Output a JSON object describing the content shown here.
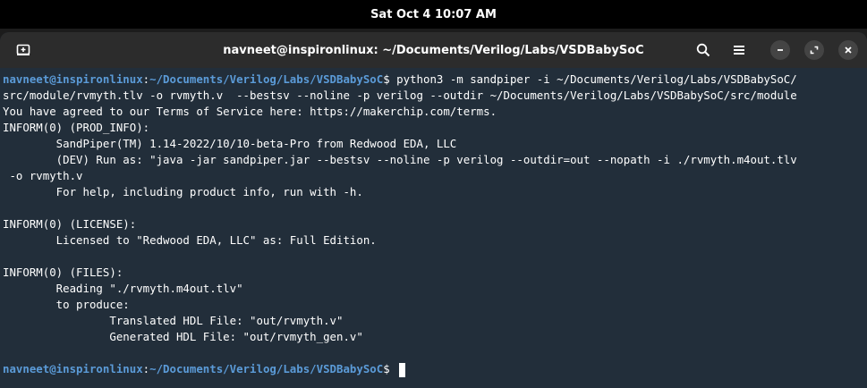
{
  "system": {
    "clock": "Sat Oct 4  10:07 AM"
  },
  "window": {
    "title": "navneet@inspironlinux: ~/Documents/Verilog/Labs/VSDBabySoC",
    "icons": [
      "new-tab-icon",
      "search-icon",
      "menu-icon",
      "minimize-icon",
      "maximize-icon",
      "close-icon"
    ]
  },
  "colors": {
    "terminal_bg": "#222e3a",
    "prompt_blue": "#5b9bd8",
    "titlebar": "#2c2c2c"
  },
  "terminal": {
    "prompt1": {
      "user": "navneet@inspironlinux",
      "sep": ":",
      "path": "~/Documents/Verilog/Labs/VSDBabySoC",
      "sigil": "$ ",
      "command": "python3 -m sandpiper -i ~/Documents/Verilog/Labs/VSDBabySoC/"
    },
    "lines": [
      "src/module/rvmyth.tlv -o rvmyth.v  --bestsv --noline -p verilog --outdir ~/Documents/Verilog/Labs/VSDBabySoC/src/module",
      "You have agreed to our Terms of Service here: https://makerchip.com/terms.",
      "INFORM(0) (PROD_INFO):",
      "        SandPiper(TM) 1.14-2022/10/10-beta-Pro from Redwood EDA, LLC",
      "        (DEV) Run as: \"java -jar sandpiper.jar --bestsv --noline -p verilog --outdir=out --nopath -i ./rvmyth.m4out.tlv",
      " -o rvmyth.v",
      "        For help, including product info, run with -h.",
      "",
      "INFORM(0) (LICENSE):",
      "        Licensed to \"Redwood EDA, LLC\" as: Full Edition.",
      "",
      "INFORM(0) (FILES):",
      "        Reading \"./rvmyth.m4out.tlv\"",
      "        to produce:",
      "                Translated HDL File: \"out/rvmyth.v\"",
      "                Generated HDL File: \"out/rvmyth_gen.v\"",
      ""
    ],
    "prompt2": {
      "user": "navneet@inspironlinux",
      "sep": ":",
      "path": "~/Documents/Verilog/Labs/VSDBabySoC",
      "sigil": "$ "
    }
  }
}
